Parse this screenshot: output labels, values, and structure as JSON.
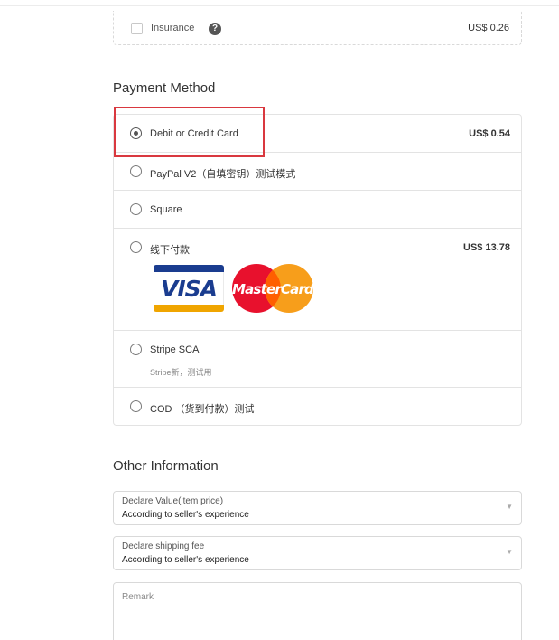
{
  "insurance": {
    "label": "Insurance",
    "help_glyph": "?",
    "price": "US$ 0.26",
    "checked": false
  },
  "payment": {
    "title": "Payment Method",
    "methods": [
      {
        "label": "Debit or Credit Card",
        "price": "US$ 0.54",
        "selected": true,
        "sub": ""
      },
      {
        "label": "PayPal V2（自填密钥）测试模式",
        "price": "",
        "selected": false,
        "sub": ""
      },
      {
        "label": "Square",
        "price": "",
        "selected": false,
        "sub": ""
      },
      {
        "label": "线下付款",
        "price": "US$ 13.78",
        "selected": false,
        "sub": ""
      },
      {
        "label": "Stripe SCA",
        "price": "",
        "selected": false,
        "sub": "Stripe新，测试用"
      },
      {
        "label": "COD （货到付款）测试",
        "price": "",
        "selected": false,
        "sub": ""
      }
    ],
    "card_logos": {
      "visa": "VISA",
      "mastercard": "MasterCard"
    }
  },
  "other": {
    "title": "Other Information",
    "declare_value": {
      "label": "Declare Value(item price)",
      "value": "According to seller's experience"
    },
    "declare_shipping": {
      "label": "Declare shipping fee",
      "value": "According to seller's experience"
    },
    "remark": {
      "placeholder": "Remark",
      "value": ""
    }
  },
  "colors": {
    "highlight": "#d9383f",
    "visa_blue": "#1a3c8f",
    "visa_gold": "#f0a500",
    "mc_red": "#e8112d",
    "mc_orange": "#f79e1b"
  },
  "icons": {
    "help": "question-circle-icon",
    "select_arrow": "chevron-down-icon"
  }
}
